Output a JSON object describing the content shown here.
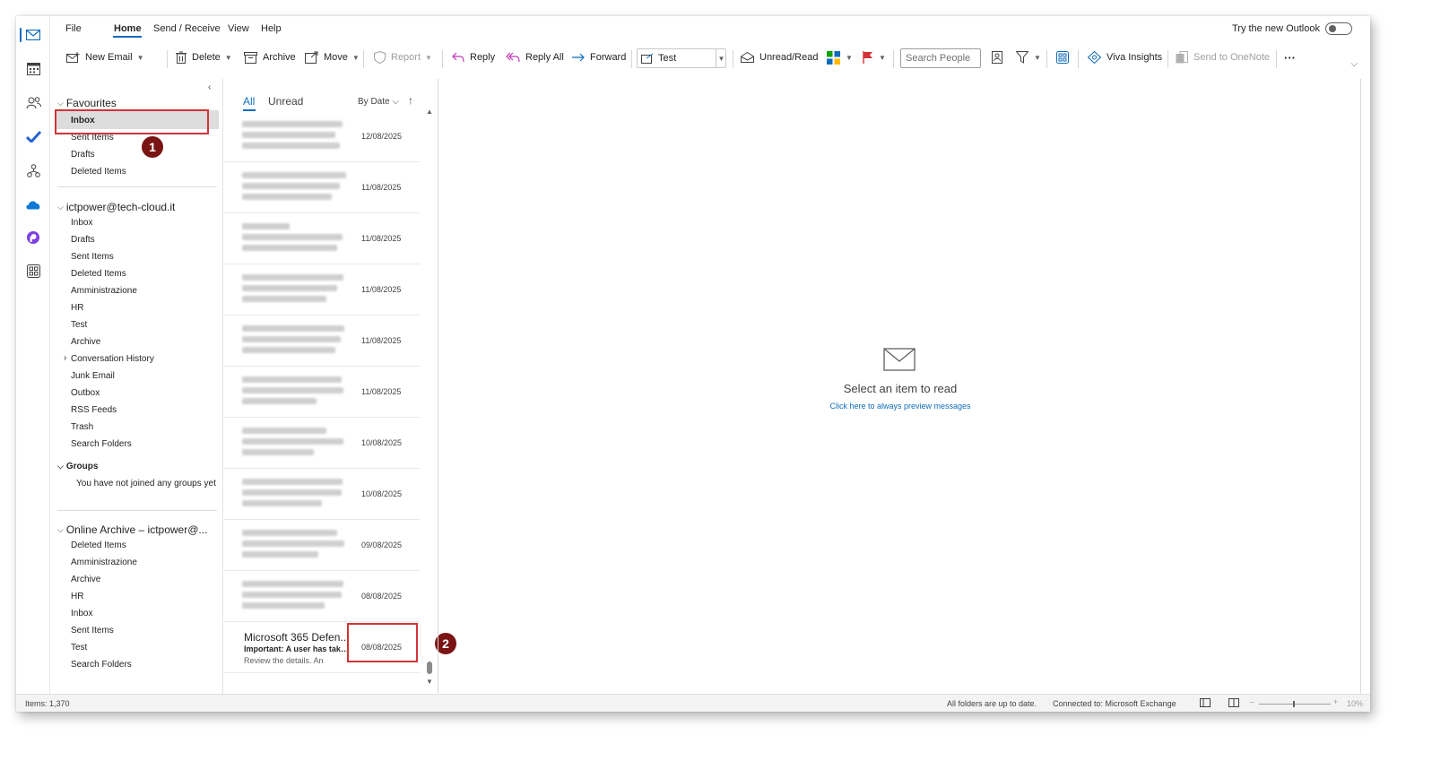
{
  "menu": {
    "tabs": [
      "File",
      "Home",
      "Send / Receive",
      "View",
      "Help"
    ],
    "try_new_outlook": "Try the new Outlook"
  },
  "toolbar": {
    "new_email": "New Email",
    "delete": "Delete",
    "archive": "Archive",
    "move": "Move",
    "report": "Report",
    "reply": "Reply",
    "reply_all": "Reply All",
    "forward": "Forward",
    "quick_step": "Test",
    "unread_read": "Unread/Read",
    "search_people_placeholder": "Search People",
    "viva_insights": "Viva Insights",
    "send_to_onenote": "Send to OneNote",
    "more": "···"
  },
  "folders": {
    "favourites": {
      "title": "Favourites",
      "items": [
        "Inbox",
        "Sent Items",
        "Drafts",
        "Deleted Items"
      ]
    },
    "account": {
      "title": "ictpower@tech-cloud.it",
      "items": [
        "Inbox",
        "Drafts",
        "Sent Items",
        "Deleted Items",
        "Amministrazione",
        "HR",
        "Test",
        "Archive",
        "Conversation History",
        "Junk Email",
        "Outbox",
        "RSS Feeds",
        "Trash",
        "Search Folders"
      ]
    },
    "groups": {
      "title": "Groups",
      "empty_text": "You have not joined any groups yet"
    },
    "online_archive": {
      "title": "Online Archive – ictpower@...",
      "items": [
        "Deleted Items",
        "Amministrazione",
        "Archive",
        "HR",
        "Inbox",
        "Sent Items",
        "Test",
        "Search Folders"
      ]
    }
  },
  "annotations": {
    "badge1": "1",
    "badge2": "2"
  },
  "message_list": {
    "tab_all": "All",
    "tab_unread": "Unread",
    "sort_label": "By Date",
    "sort_arrow": "↑",
    "messages": [
      {
        "date": "12/08/2025"
      },
      {
        "date": "11/08/2025"
      },
      {
        "date": "11/08/2025"
      },
      {
        "date": "11/08/2025"
      },
      {
        "date": "11/08/2025"
      },
      {
        "date": "11/08/2025"
      },
      {
        "date": "10/08/2025"
      },
      {
        "date": "10/08/2025"
      },
      {
        "date": "09/08/2025"
      },
      {
        "date": "08/08/2025"
      },
      {
        "sender": "Microsoft 365 Defen...",
        "subject": "Important: A user has take...",
        "preview": "Review the details.  An",
        "date": "08/08/2025"
      }
    ]
  },
  "reading_pane": {
    "title": "Select an item to read",
    "link": "Click here to always preview messages"
  },
  "status_bar": {
    "items": "Items: 1,370",
    "sync": "All folders are up to date.",
    "connection": "Connected to: Microsoft Exchange",
    "zoom_minus": "–",
    "zoom_plus": "+",
    "zoom": "10%"
  },
  "colors": {
    "accent": "#0f6cbd",
    "highlight_border": "#d13438",
    "badge": "#7a1414"
  }
}
